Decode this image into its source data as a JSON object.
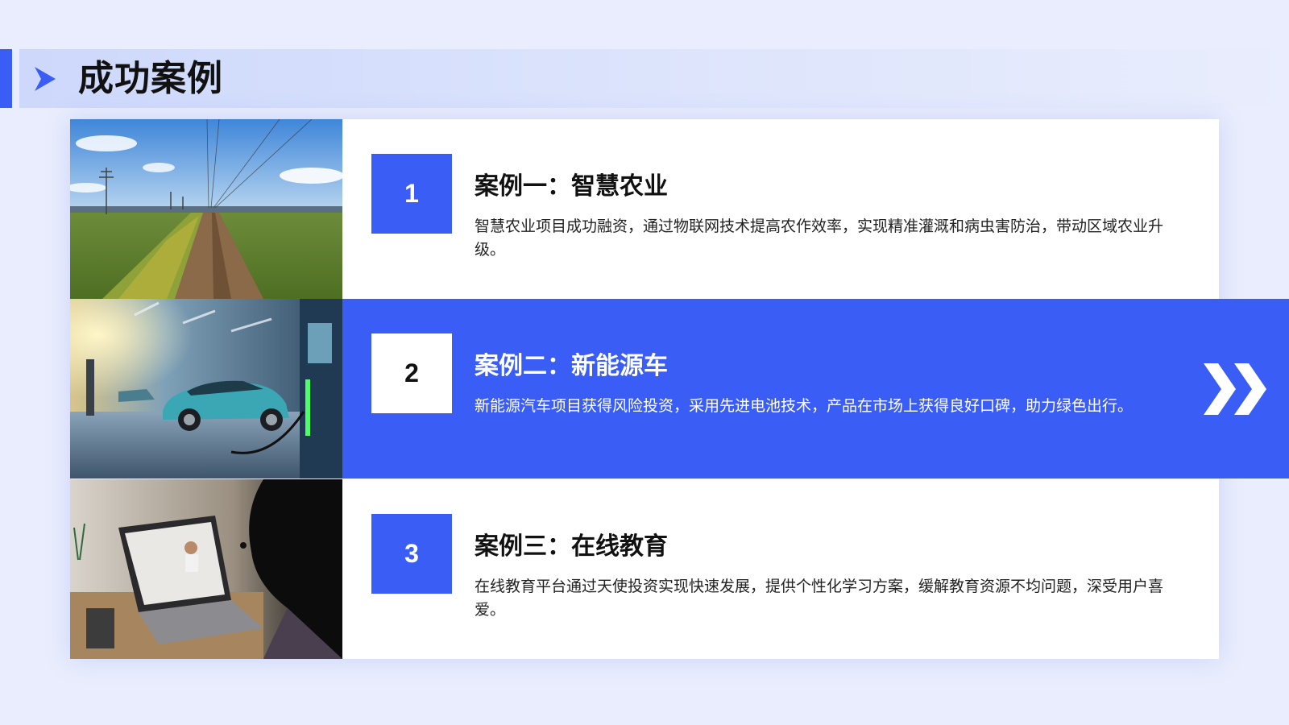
{
  "header": {
    "title": "成功案例",
    "icon": "chevron-right-icon",
    "accent_color": "#3a5ef5"
  },
  "cases": [
    {
      "number": "1",
      "title": "案例一：智慧农业",
      "description": "智慧农业项目成功融资，通过物联网技术提高农作效率，实现精准灌溉和病虫害防治，带动区域农业升级。",
      "highlighted": false
    },
    {
      "number": "2",
      "title": "案例二：新能源车",
      "description": "新能源汽车项目获得风险投资，采用先进电池技术，产品在市场上获得良好口碑，助力绿色出行。",
      "highlighted": true,
      "icon": "double-chevron-right-icon"
    },
    {
      "number": "3",
      "title": "案例三：在线教育",
      "description": "在线教育平台通过天使投资实现快速发展，提供个性化学习方案，缓解教育资源不均问题，深受用户喜爱。",
      "highlighted": false
    }
  ]
}
